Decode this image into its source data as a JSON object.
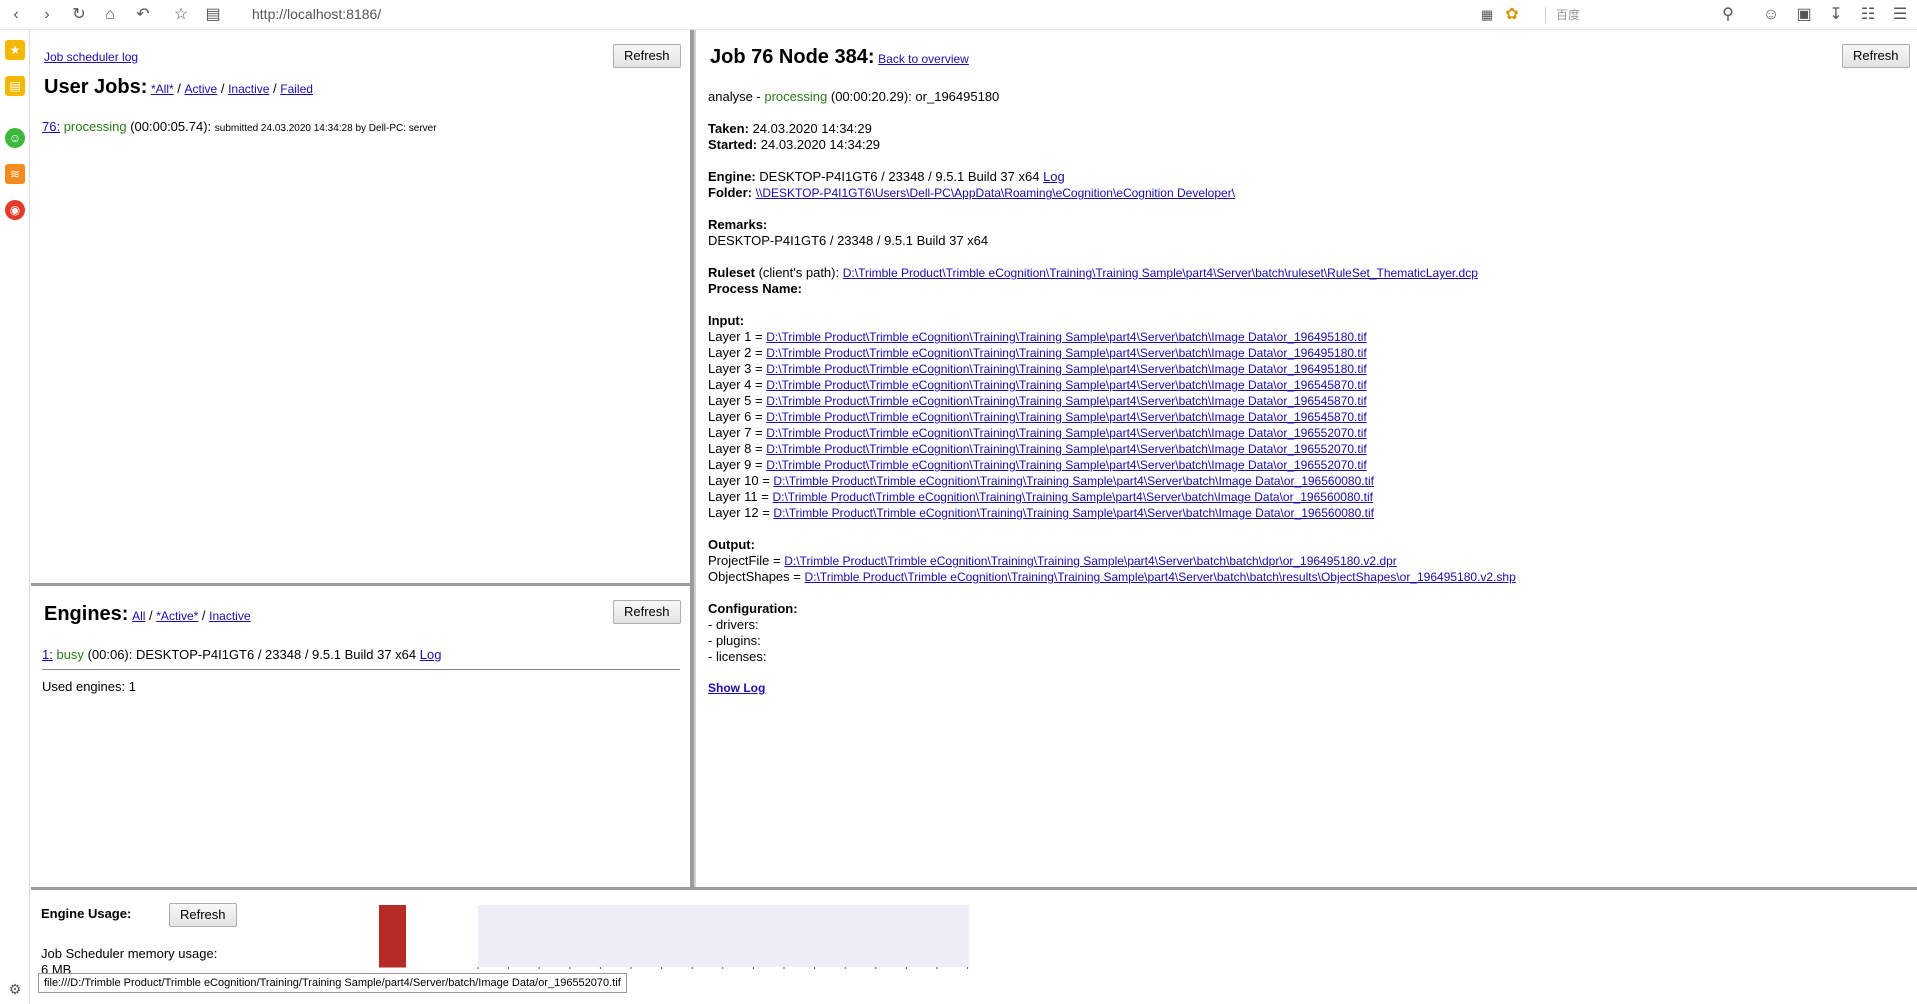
{
  "browser": {
    "url": "http://localhost:8186/",
    "search_placeholder": "百度"
  },
  "left_top": {
    "log_link": "Job scheduler log",
    "refresh": "Refresh",
    "title": "User Jobs:",
    "filters": [
      "*All*",
      "Active",
      "Inactive",
      "Failed"
    ],
    "job": {
      "id": "76:",
      "status": "processing",
      "time": "(00:00:05.74):",
      "submitted": "submitted 24.03.2020 14:34:28 by Dell-PC: server"
    }
  },
  "left_bottom": {
    "title": "Engines:",
    "filters": [
      "All",
      "*Active*",
      "Inactive"
    ],
    "refresh": "Refresh",
    "engine": {
      "id": "1:",
      "status": "busy",
      "detail": "(00:06): DESKTOP-P4I1GT6 / 23348 / 9.5.1 Build 37 x64",
      "log": "Log"
    },
    "used": "Used engines: 1"
  },
  "right": {
    "title": "Job 76 Node 384:",
    "back_link": "Back to overview",
    "refresh": "Refresh",
    "status_prefix": "analyse -",
    "status": "processing",
    "status_suffix": "(00:00:20.29): or_196495180",
    "taken_label": "Taken:",
    "taken": "24.03.2020 14:34:29",
    "started_label": "Started:",
    "started": "24.03.2020 14:34:29",
    "engine_label": "Engine:",
    "engine": "DESKTOP-P4I1GT6 / 23348 / 9.5.1 Build 37 x64",
    "engine_log": "Log",
    "folder_label": "Folder:",
    "folder": "\\\\DESKTOP-P4I1GT6\\Users\\Dell-PC\\AppData\\Roaming\\eCognition\\eCognition Developer\\",
    "remarks_label": "Remarks:",
    "remarks": "DESKTOP-P4I1GT6 / 23348 / 9.5.1 Build 37 x64",
    "ruleset_label": "Ruleset",
    "ruleset_note": "(client's path):",
    "ruleset": "D:\\Trimble Product\\Trimble eCognition\\Training\\Training Sample\\part4\\Server\\batch\\ruleset\\RuleSet_ThematicLayer.dcp",
    "process_label": "Process Name:",
    "input_label": "Input:",
    "layers": [
      {
        "label": "Layer 1 =",
        "path": "D:\\Trimble Product\\Trimble eCognition\\Training\\Training Sample\\part4\\Server\\batch\\Image Data\\or_196495180.tif"
      },
      {
        "label": "Layer 2 =",
        "path": "D:\\Trimble Product\\Trimble eCognition\\Training\\Training Sample\\part4\\Server\\batch\\Image Data\\or_196495180.tif"
      },
      {
        "label": "Layer 3 =",
        "path": "D:\\Trimble Product\\Trimble eCognition\\Training\\Training Sample\\part4\\Server\\batch\\Image Data\\or_196495180.tif"
      },
      {
        "label": "Layer 4 =",
        "path": "D:\\Trimble Product\\Trimble eCognition\\Training\\Training Sample\\part4\\Server\\batch\\Image Data\\or_196545870.tif"
      },
      {
        "label": "Layer 5 =",
        "path": "D:\\Trimble Product\\Trimble eCognition\\Training\\Training Sample\\part4\\Server\\batch\\Image Data\\or_196545870.tif"
      },
      {
        "label": "Layer 6 =",
        "path": "D:\\Trimble Product\\Trimble eCognition\\Training\\Training Sample\\part4\\Server\\batch\\Image Data\\or_196545870.tif"
      },
      {
        "label": "Layer 7 =",
        "path": "D:\\Trimble Product\\Trimble eCognition\\Training\\Training Sample\\part4\\Server\\batch\\Image Data\\or_196552070.tif"
      },
      {
        "label": "Layer 8 =",
        "path": "D:\\Trimble Product\\Trimble eCognition\\Training\\Training Sample\\part4\\Server\\batch\\Image Data\\or_196552070.tif"
      },
      {
        "label": "Layer 9 =",
        "path": "D:\\Trimble Product\\Trimble eCognition\\Training\\Training Sample\\part4\\Server\\batch\\Image Data\\or_196552070.tif"
      },
      {
        "label": "Layer 10 =",
        "path": "D:\\Trimble Product\\Trimble eCognition\\Training\\Training Sample\\part4\\Server\\batch\\Image Data\\or_196560080.tif"
      },
      {
        "label": "Layer 11 =",
        "path": "D:\\Trimble Product\\Trimble eCognition\\Training\\Training Sample\\part4\\Server\\batch\\Image Data\\or_196560080.tif"
      },
      {
        "label": "Layer 12 =",
        "path": "D:\\Trimble Product\\Trimble eCognition\\Training\\Training Sample\\part4\\Server\\batch\\Image Data\\or_196560080.tif"
      }
    ],
    "output_label": "Output:",
    "outputs": [
      {
        "label": "ProjectFile =",
        "path": "D:\\Trimble Product\\Trimble eCognition\\Training\\Training Sample\\part4\\Server\\batch\\batch\\dpr\\or_196495180.v2.dpr"
      },
      {
        "label": "ObjectShapes =",
        "path": "D:\\Trimble Product\\Trimble eCognition\\Training\\Training Sample\\part4\\Server\\batch\\batch\\results\\ObjectShapes\\or_196495180.v2.shp"
      }
    ],
    "config_label": "Configuration:",
    "config": [
      "- drivers:",
      "- plugins:",
      "- licenses:"
    ],
    "show_log": "Show Log"
  },
  "bottom": {
    "title": "Engine Usage:",
    "refresh": "Refresh",
    "memory_label": "Job Scheduler memory usage:",
    "memory_value": "6 MB",
    "usage_bar_color": "#b52b25",
    "plot_bg_color": "#ededf7"
  },
  "status_tooltip": "file:///D:/Trimble Product/Trimble eCognition/Training/Training Sample/part4/Server/batch/Image Data/or_196552070.tif"
}
